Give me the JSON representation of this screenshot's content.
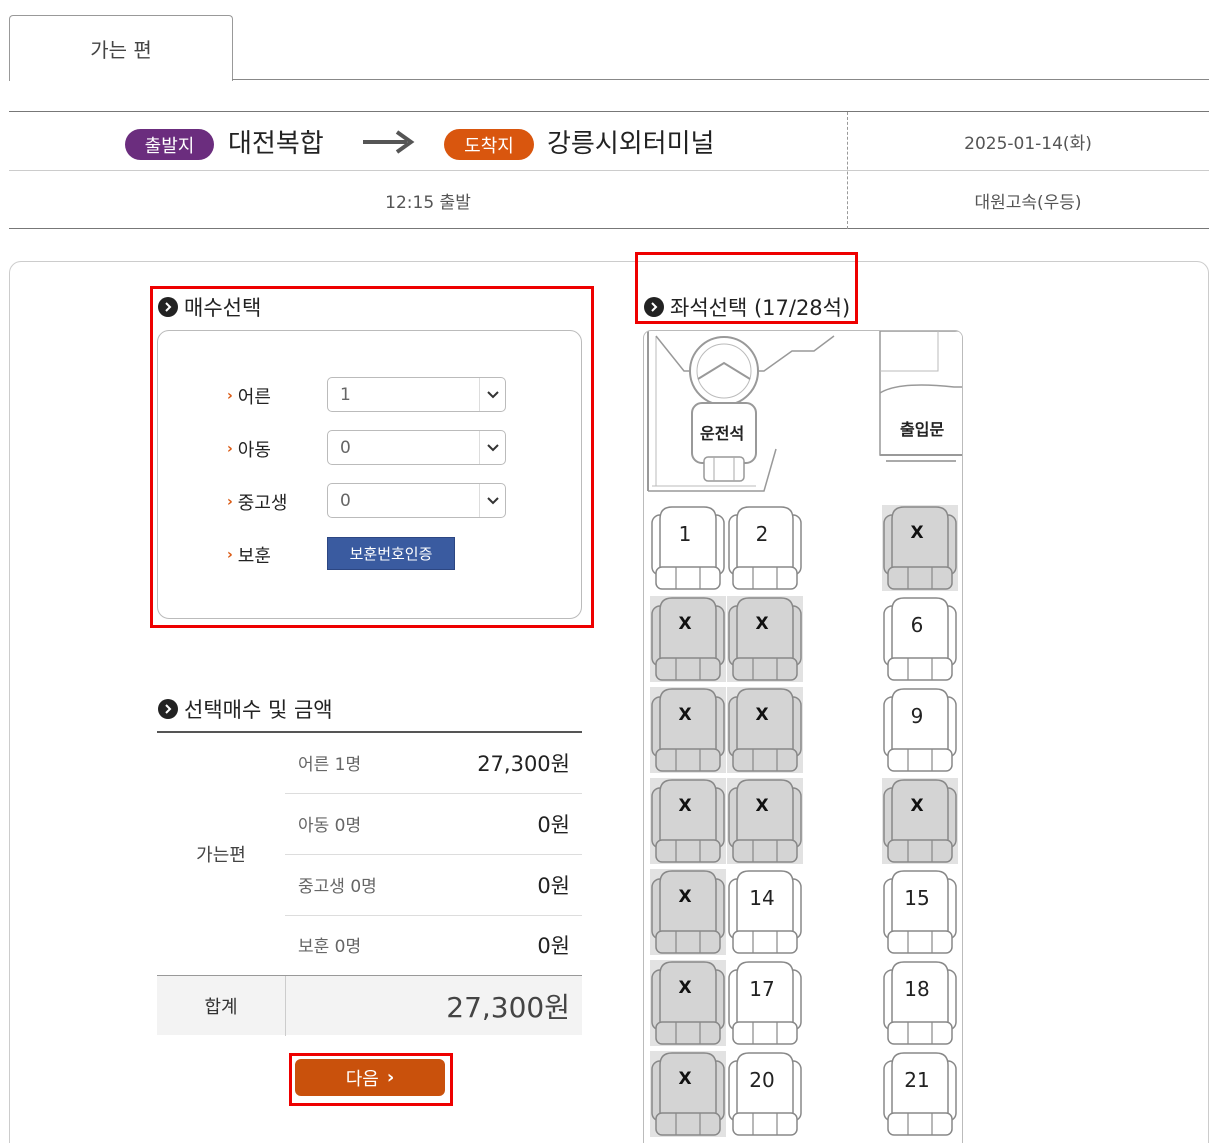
{
  "tab": {
    "label": "가는 편"
  },
  "route": {
    "departure_badge": "출발지",
    "departure": "대전복합",
    "arrival_badge": "도착지",
    "arrival": "강릉시외터미널",
    "date": "2025-01-14(화)",
    "time": "12:15 출발",
    "company": "대원고속(우등)"
  },
  "count_section": {
    "title": "매수선택",
    "rows": [
      {
        "label": "어른",
        "value": "1"
      },
      {
        "label": "아동",
        "value": "0"
      },
      {
        "label": "중고생",
        "value": "0"
      },
      {
        "label": "보훈",
        "button": "보훈번호인증"
      }
    ]
  },
  "summary": {
    "title": "선택매수 및 금액",
    "group": "가는편",
    "rows": [
      {
        "label": "어른 1명",
        "value": "27,300원"
      },
      {
        "label": "아동 0명",
        "value": "0원"
      },
      {
        "label": "중고생 0명",
        "value": "0원"
      },
      {
        "label": "보훈 0명",
        "value": "0원"
      }
    ],
    "total_label": "합계",
    "total_value": "27,300원"
  },
  "next_button": "다음",
  "seat_section": {
    "title": "좌석선택 (17/28석)",
    "driver_label": "운전석",
    "door_label": "출입문",
    "seats": [
      {
        "label": "1",
        "taken": false
      },
      {
        "label": "2",
        "taken": false
      },
      {
        "label": "X",
        "taken": true
      },
      {
        "label": "X",
        "taken": true
      },
      {
        "label": "X",
        "taken": true
      },
      {
        "label": "6",
        "taken": false
      },
      {
        "label": "X",
        "taken": true
      },
      {
        "label": "X",
        "taken": true
      },
      {
        "label": "9",
        "taken": false
      },
      {
        "label": "X",
        "taken": true
      },
      {
        "label": "X",
        "taken": true
      },
      {
        "label": "X",
        "taken": true
      },
      {
        "label": "X",
        "taken": true
      },
      {
        "label": "14",
        "taken": false
      },
      {
        "label": "15",
        "taken": false
      },
      {
        "label": "X",
        "taken": true
      },
      {
        "label": "17",
        "taken": false
      },
      {
        "label": "18",
        "taken": false
      },
      {
        "label": "X",
        "taken": true
      },
      {
        "label": "20",
        "taken": false
      },
      {
        "label": "21",
        "taken": false
      }
    ]
  },
  "colors": {
    "departure_badge": "#6b2d7e",
    "arrival_badge": "#d9560e",
    "next_button": "#c9510c",
    "verify_button": "#3a5ba0",
    "highlight": "#e00000"
  }
}
